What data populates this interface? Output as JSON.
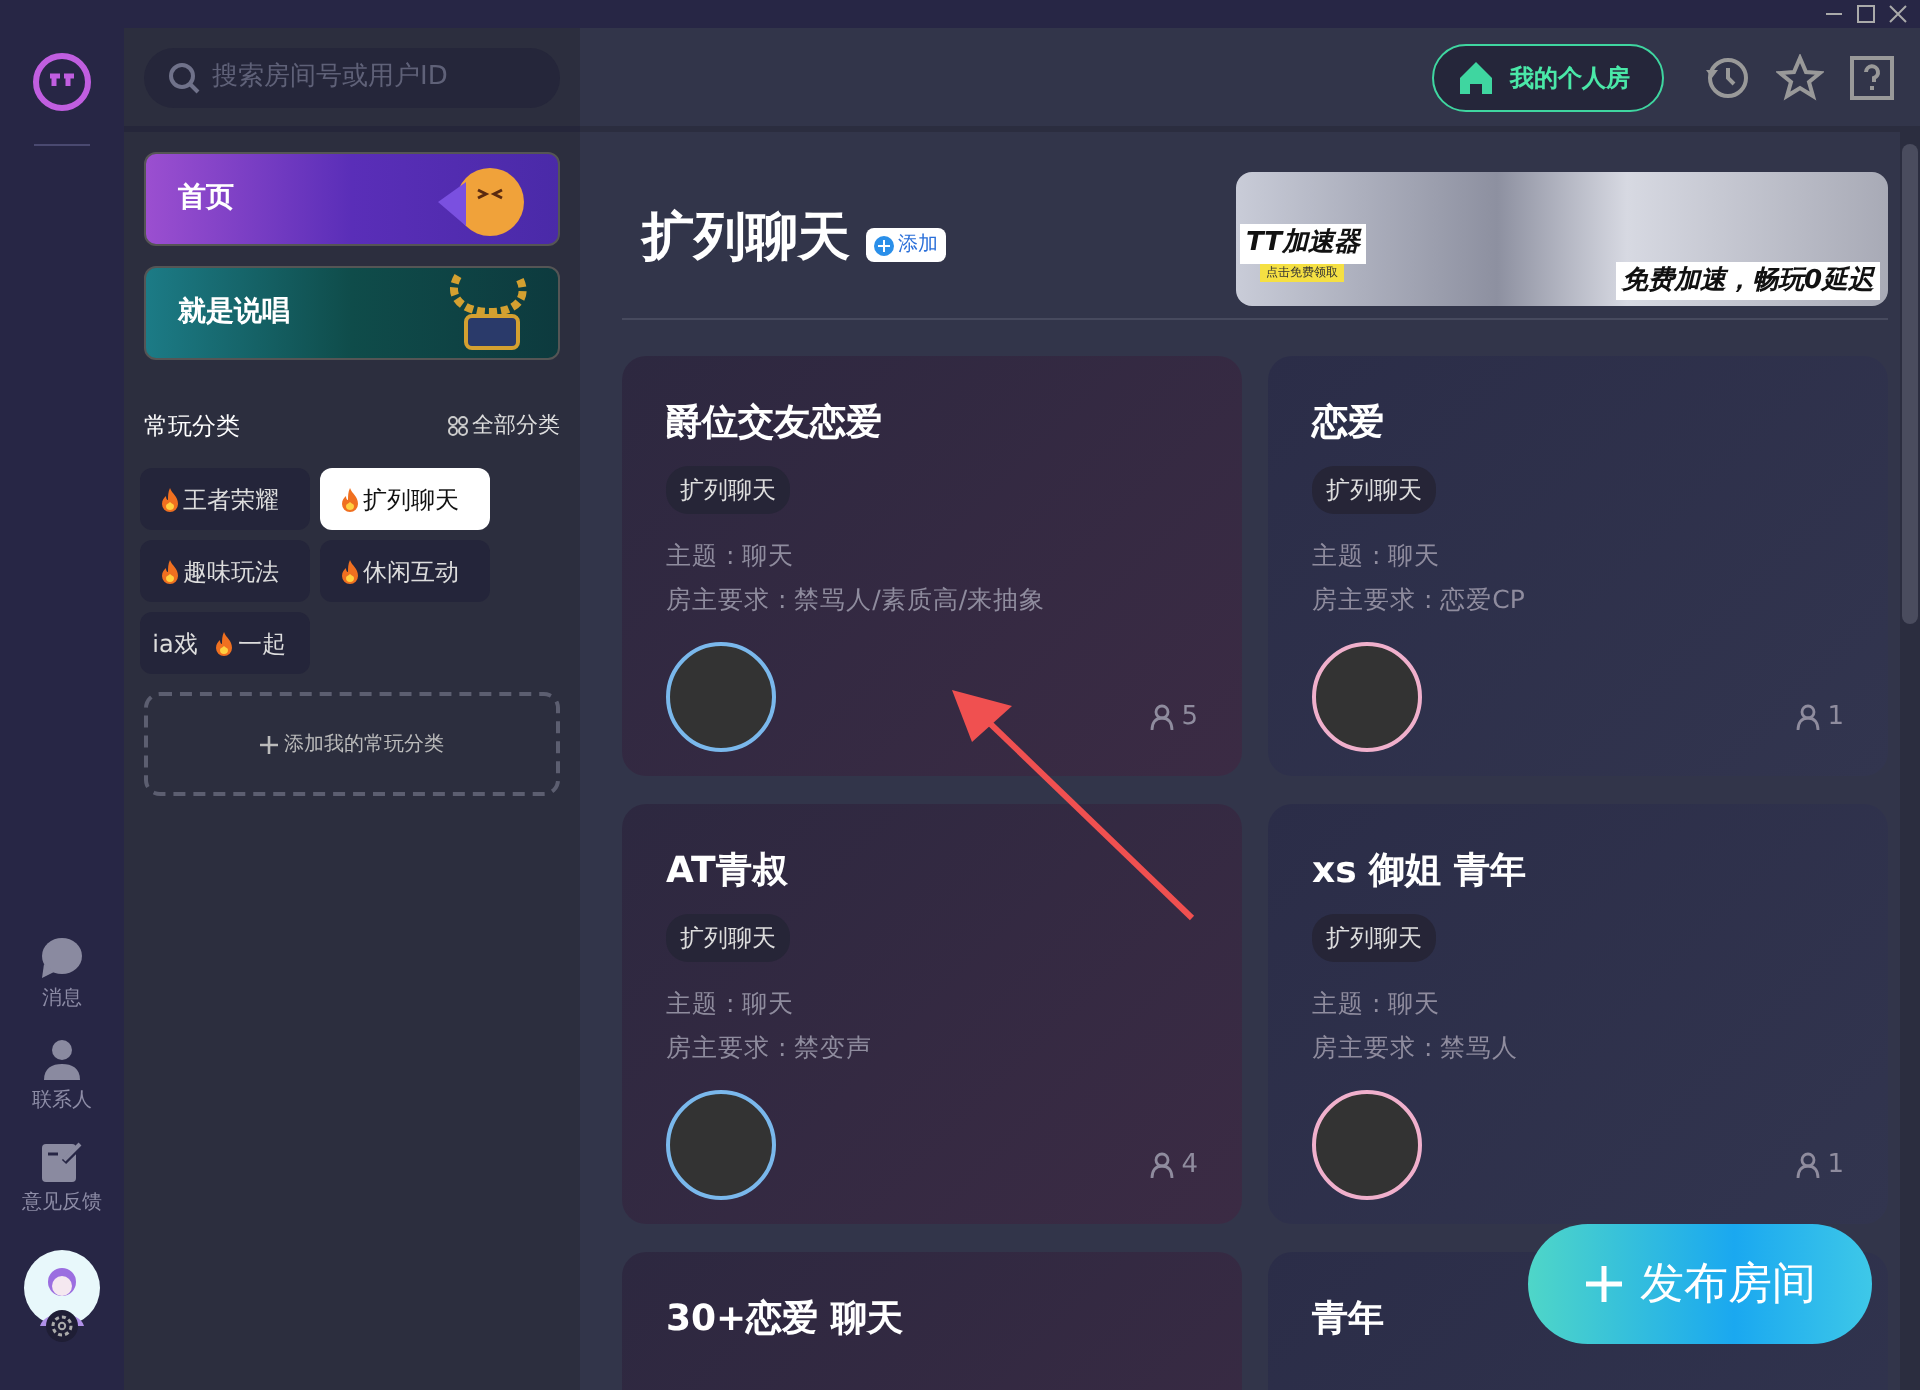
{
  "rail": {
    "nav": [
      {
        "kind": "message",
        "label": "消息"
      },
      {
        "kind": "contact",
        "label": "联系人"
      },
      {
        "kind": "feedback",
        "label": "意见反馈"
      }
    ]
  },
  "sidebar": {
    "search": {
      "placeholder": "搜索房间号或用户ID"
    },
    "banners": [
      {
        "kind": "home",
        "label": "首页"
      },
      {
        "kind": "rap",
        "label": "就是说唱"
      }
    ],
    "section_title": "常玩分类",
    "all_link": "全部分类",
    "categories": [
      {
        "selected": false,
        "parts": [
          {
            "text": "王者荣耀",
            "hot": true
          }
        ]
      },
      {
        "selected": true,
        "parts": [
          {
            "text": "扩列聊天",
            "hot": true
          }
        ]
      },
      {
        "selected": false,
        "parts": [
          {
            "text": "趣味玩法",
            "hot": true
          }
        ]
      },
      {
        "selected": false,
        "parts": [
          {
            "text": "休闲互动",
            "hot": true
          }
        ]
      },
      {
        "selected": false,
        "parts": [
          {
            "text": "ia戏",
            "hot": false
          },
          {
            "text": "一起",
            "hot": true
          }
        ]
      }
    ],
    "add_label": "添加我的常玩分类"
  },
  "header": {
    "my_room": "我的个人房"
  },
  "main": {
    "title": "扩列聊天",
    "add_button": "添加",
    "ad": {
      "brand": "TT加速器",
      "cta": "点击免费领取",
      "slogan": "免费加速，畅玩0延迟"
    },
    "rooms": [
      {
        "title": "爵位交友恋爱",
        "tag": "扩列聊天",
        "topic": "主题 : 聊天",
        "rule": "房主要求 : 禁骂人/素质高/来抽象",
        "color": "#7ab8ec",
        "count": "5"
      },
      {
        "title": "恋爱",
        "tag": "扩列聊天",
        "topic": "主题 : 聊天",
        "rule": "房主要求 : 恋爱CP",
        "color": "#f0b0cc",
        "count": "1"
      },
      {
        "title": "AT青叔",
        "tag": "扩列聊天",
        "topic": "主题 : 聊天",
        "rule": "房主要求 : 禁变声",
        "color": "#7ab8ec",
        "count": "4"
      },
      {
        "title": "xs 御姐 青年",
        "tag": "扩列聊天",
        "topic": "主题 : 聊天",
        "rule": "房主要求 : 禁骂人",
        "color": "#f0b0cc",
        "count": "1"
      },
      {
        "title": "30+恋爱 聊天"
      },
      {
        "title": "青年"
      }
    ],
    "publish": "发布房间"
  }
}
